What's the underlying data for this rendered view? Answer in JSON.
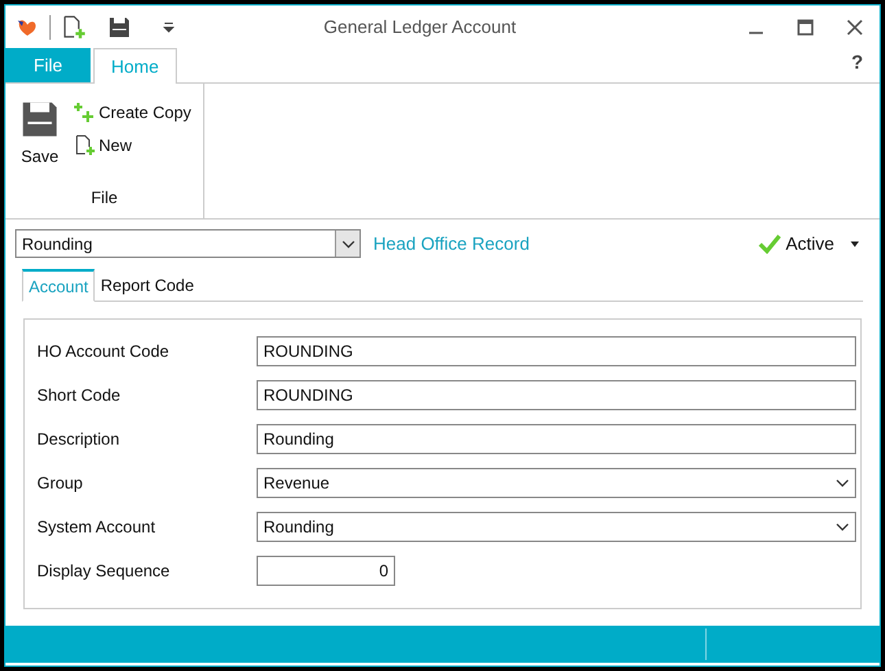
{
  "window": {
    "title": "General Ledger Account"
  },
  "ribbon_tabs": [
    {
      "label": "File",
      "kind": "file",
      "selected": false
    },
    {
      "label": "Home",
      "kind": "tab",
      "selected": true
    }
  ],
  "help": "?",
  "ribbon": {
    "save": "Save",
    "create_copy": "Create Copy",
    "new": "New",
    "group": "File"
  },
  "record": {
    "value": "Rounding",
    "link": "Head Office Record",
    "status": "Active"
  },
  "tabs": [
    {
      "label": "Account",
      "selected": true
    },
    {
      "label": "Report Code",
      "selected": false
    }
  ],
  "fields": [
    {
      "label": "HO Account Code",
      "value": "ROUNDING",
      "kind": "text"
    },
    {
      "label": "Short Code",
      "value": "ROUNDING",
      "kind": "text"
    },
    {
      "label": "Description",
      "value": "Rounding",
      "kind": "text"
    },
    {
      "label": "Group",
      "value": "Revenue",
      "kind": "select"
    },
    {
      "label": "System Account",
      "value": "Rounding",
      "kind": "select"
    },
    {
      "label": "Display Sequence",
      "value": "0",
      "kind": "number"
    }
  ]
}
